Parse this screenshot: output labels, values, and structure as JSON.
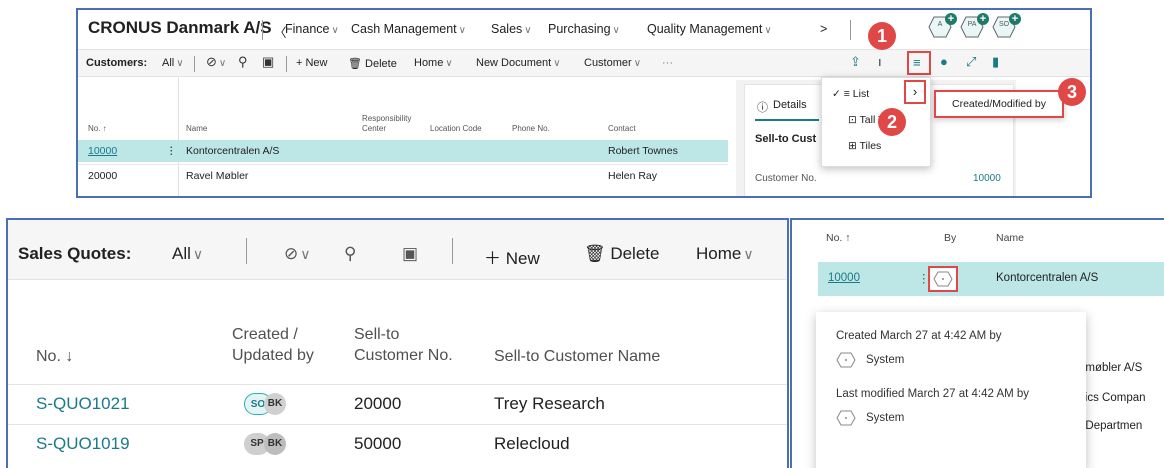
{
  "top_panel": {
    "company": "CRONUS Danmark A/S",
    "nav": [
      "Finance",
      "Cash Management",
      "Sales",
      "Purchasing",
      "Quality Management"
    ],
    "nav_more": ">",
    "badges": [
      "A",
      "PA",
      "SO"
    ],
    "toolbar": {
      "page_label": "Customers:",
      "filter": "All",
      "new": "New",
      "delete": "Delete",
      "home": "Home",
      "new_document": "New Document",
      "customer": "Customer",
      "more": "···"
    },
    "columns": {
      "no": "No. ↑",
      "name": "Name",
      "responsibility": "Responsibility Center",
      "location": "Location Code",
      "phone": "Phone No.",
      "contact": "Contact"
    },
    "rows": [
      {
        "no": "10000",
        "name": "Kontorcentralen A/S",
        "contact": "Robert Townes"
      },
      {
        "no": "20000",
        "name": "Ravel Møbler",
        "contact": "Helen Ray"
      }
    ],
    "factbox": {
      "tab": "Details",
      "section": "Sell-to Cust",
      "customer_no_label": "Customer No.",
      "customer_no_value": "10000"
    },
    "menu": {
      "list": "List",
      "tall_tiles": "Tall Tile",
      "tiles": "Tiles",
      "submenu": "Created/Modified by"
    },
    "callouts": [
      "1",
      "2",
      "3"
    ]
  },
  "sales_quotes": {
    "page_label": "Sales Quotes:",
    "filter": "All",
    "new": "New",
    "delete": "Delete",
    "home": "Home",
    "columns": {
      "no": "No. ↓",
      "created_l1": "Created /",
      "created_l2": "Updated by",
      "sellto_l1": "Sell-to",
      "sellto_l2": "Customer No.",
      "sellto_name": "Sell-to Customer Name"
    },
    "rows": [
      {
        "no": "S-QUO1021",
        "chip1": "SO",
        "chip2": "BK",
        "customer_no": "20000",
        "customer_name": "Trey Research"
      },
      {
        "no": "S-QUO1019",
        "chip1": "SP",
        "chip2": "BK",
        "customer_no": "50000",
        "customer_name": "Relecloud"
      }
    ]
  },
  "created_popup": {
    "columns": {
      "no": "No. ↑",
      "by": "By",
      "name": "Name"
    },
    "row": {
      "no": "10000",
      "name": "Kontorcentralen A/S"
    },
    "created": "Created March 27 at 4:42 AM by",
    "created_user": "System",
    "modified": "Last modified March 27 at 4:42 AM by",
    "modified_user": "System",
    "behind_rows": [
      "tormøbler A/S",
      "phics Compan",
      "er Departmen"
    ]
  },
  "colors": {
    "accent": "#1a7a86",
    "selected_row": "#bde6e7",
    "callout": "#e04848",
    "panel_border": "#4a6fb5"
  }
}
